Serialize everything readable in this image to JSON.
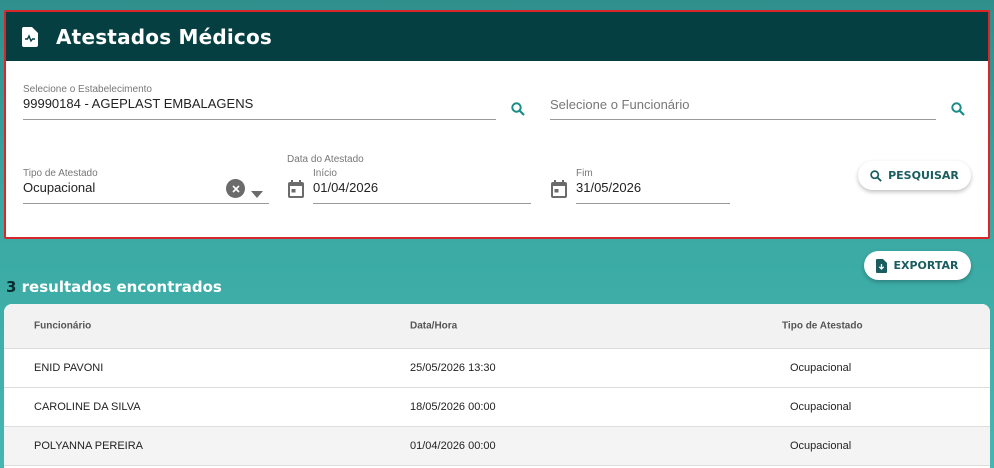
{
  "header": {
    "title": "Atestados Médicos",
    "icon": "medical-document-icon"
  },
  "filters": {
    "establishment": {
      "label": "Selecione o Estabelecimento",
      "value": "99990184 - AGEPLAST EMBALAGENS"
    },
    "employee": {
      "placeholder": "Selecione o Funcionário"
    },
    "type": {
      "label": "Tipo de Atestado",
      "value": "Ocupacional"
    },
    "date_group_label": "Data do Atestado",
    "start": {
      "label": "Início",
      "value": "01/04/2026"
    },
    "end": {
      "label": "Fim",
      "value": "31/05/2026"
    },
    "search_label": "PESQUISAR"
  },
  "export_label": "EXPORTAR",
  "results": {
    "count": "3",
    "text": " resultados encontrados"
  },
  "table": {
    "columns": [
      "Funcionário",
      "Data/Hora",
      "Tipo de Atestado"
    ],
    "rows": [
      [
        "ENID PAVONI",
        "25/05/2026 13:30",
        "Ocupacional"
      ],
      [
        "CAROLINE DA SILVA",
        "18/05/2026 00:00",
        "Ocupacional"
      ],
      [
        "POLYANNA PEREIRA",
        "01/04/2026 00:00",
        "Ocupacional"
      ]
    ]
  },
  "colors": {
    "header_bg": "#063f42",
    "accent": "#1b8c86",
    "highlight_border": "#d9262b"
  }
}
